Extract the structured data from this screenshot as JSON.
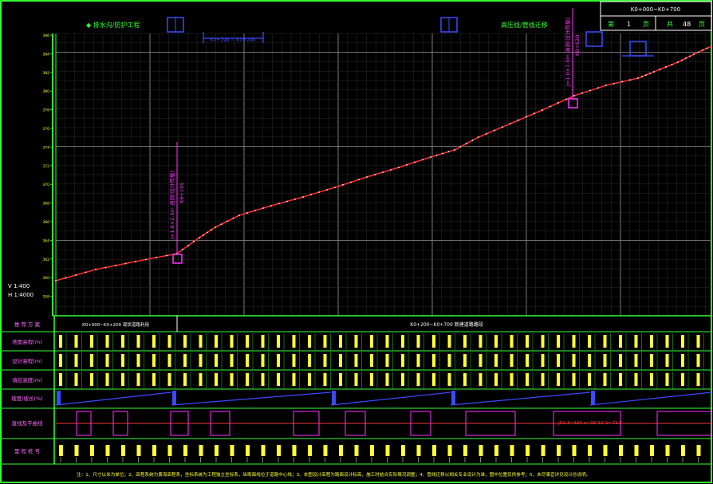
{
  "title_block": {
    "range": "K0+000~K0+700",
    "sheet_label": "第",
    "sheet_no": "1",
    "sheet_unit": "页",
    "total_label": "共",
    "total_no": "48",
    "total_unit": "页"
  },
  "top_labels": {
    "left": "◆ 排水沟/防护工程",
    "right": "高压线/管线迁移"
  },
  "scale": {
    "vertical": "V 1:400",
    "horizontal": "H 1:4000"
  },
  "annotations": {
    "left_vertical": "J=1.6×2.5m 涵洞(设计荷载)",
    "left_vertical_2": "K0+195",
    "right_vertical": "J=1.0×1.0m 涵洞(设计荷载)",
    "right_vertical_2": "K0+620",
    "top_span": "K0+198 ~ K0+245"
  },
  "profile": {
    "y_ticks": [
      "386",
      "384",
      "382",
      "380",
      "378",
      "376",
      "374",
      "372",
      "370",
      "368",
      "366",
      "364",
      "362",
      "360",
      "358"
    ],
    "ground_line_color": "#ff2a2a",
    "design_line_color": "#ffffff",
    "grid_color": "#5a5a5a",
    "frame_color": "#33ff33"
  },
  "bottom_table": {
    "row_labels": [
      "推 荐 方 案",
      "地面高程(m)",
      "设计高程(m)",
      "填挖高度(m)",
      "坡度/坡长(%)",
      "直线及平曲线",
      "里 程 桩 号"
    ],
    "scheme_left": "K0+000~K0+200 现状道路利用",
    "scheme_right": "K0+200~K0+700 新建道路路段",
    "curve_note": "JD1 R=160 α=38°10′ L=72.5",
    "footnote": "注：1、尺寸以米为单位；2、高程系统为黄海高程系，坐标系统为工程独立坐标系，纵断面线位于道路中心线；3、本图设计高程为路面设计标高，施工时结合实际情况调整；4、管线迁移以相关专业设计为准，图中位置仅供参考；5、未尽事宜详见设计总说明。"
  }
}
